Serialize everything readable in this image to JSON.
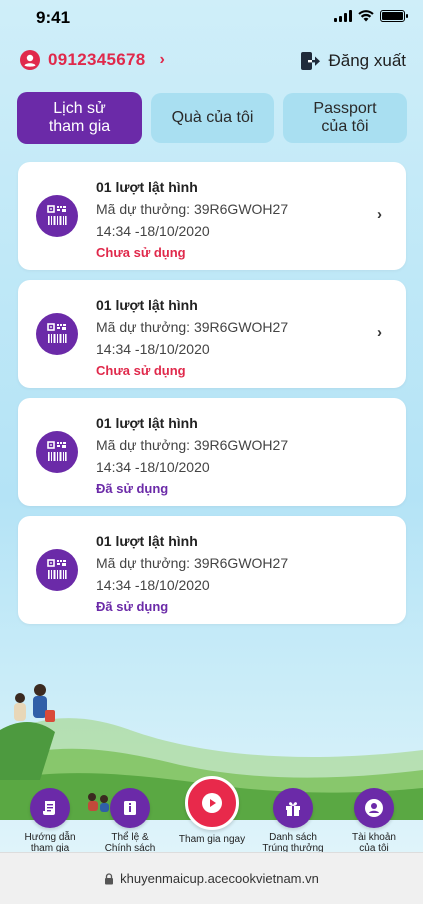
{
  "status_bar": {
    "time": "9:41"
  },
  "header": {
    "phone": "0912345678",
    "logout_label": "Đăng xuất"
  },
  "tabs": [
    {
      "label_line1": "Lịch sử",
      "label_line2": "tham gia",
      "active": true
    },
    {
      "label_line1": "Quà của tôi",
      "label_line2": "",
      "active": false
    },
    {
      "label_line1": "Passport",
      "label_line2": "của tôi",
      "active": false
    }
  ],
  "cards": [
    {
      "title": "01 lượt lật hình",
      "code": "Mã dự thưởng: 39R6GWOH27",
      "date": "14:34 -18/10/2020",
      "status": "Chưa sử dụng",
      "status_color": "#e0294b",
      "has_chevron": true
    },
    {
      "title": "01 lượt lật hình",
      "code": "Mã dự thưởng: 39R6GWOH27",
      "date": "14:34 -18/10/2020",
      "status": "Chưa sử dụng",
      "status_color": "#e0294b",
      "has_chevron": true
    },
    {
      "title": "01 lượt lật hình",
      "code": "Mã dự thưởng: 39R6GWOH27",
      "date": "14:34 -18/10/2020",
      "status": "Đã sử dụng",
      "status_color": "#6b2aa8",
      "has_chevron": false
    },
    {
      "title": "01 lượt lật hình",
      "code": "Mã dự thưởng: 39R6GWOH27",
      "date": "14:34 -18/10/2020",
      "status": "Đã sử dụng",
      "status_color": "#6b2aa8",
      "has_chevron": false
    }
  ],
  "bottom_nav": [
    {
      "line1": "Hướng dẫn",
      "line2": "tham gia",
      "icon": "scroll-icon"
    },
    {
      "line1": "Thể lệ &",
      "line2": "Chính sách",
      "icon": "info-book-icon"
    },
    {
      "line1": "Tham gia ngay",
      "line2": "",
      "icon": "play-icon"
    },
    {
      "line1": "Danh sách",
      "line2": "Trúng thưởng",
      "icon": "gift-icon"
    },
    {
      "line1": "Tài khoản",
      "line2": "của tôi",
      "icon": "account-icon"
    }
  ],
  "url_bar": {
    "url": "khuyenmaicup.acecookvietnam.vn"
  },
  "colors": {
    "accent": "#6b2aa8",
    "primary_red": "#e0294b",
    "tab_inactive": "#a9dff1"
  }
}
